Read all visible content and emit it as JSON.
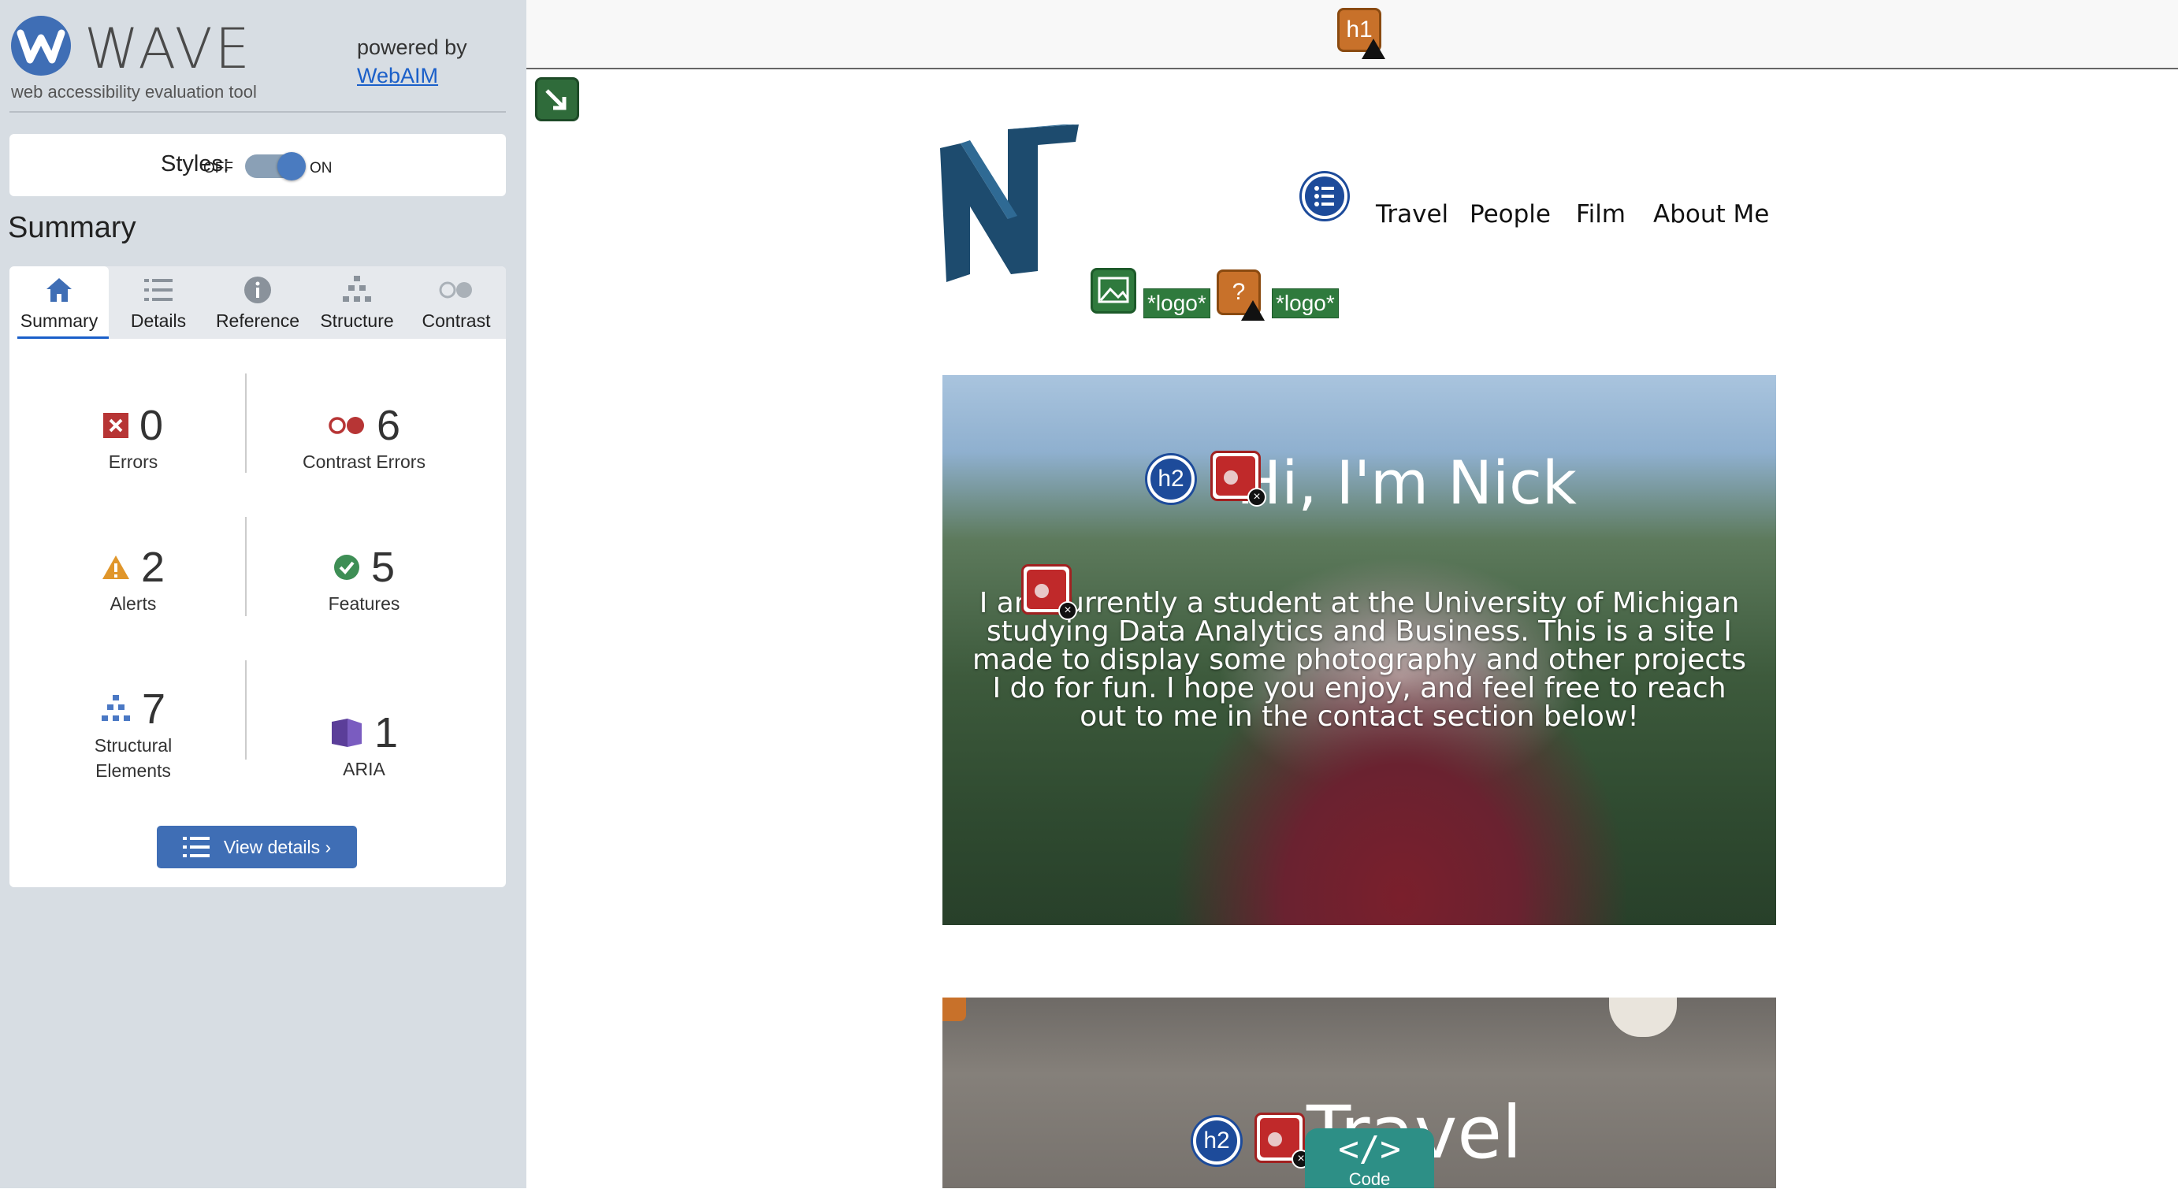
{
  "wave": {
    "name": "WAVE",
    "tagline": "web accessibility evaluation tool",
    "powered_by": "powered by",
    "powered_link": "WebAIM",
    "styles_label": "Styles:",
    "styles_off": "OFF",
    "styles_on": "ON",
    "summary_heading": "Summary",
    "tabs": [
      {
        "label": "Summary",
        "icon": "home-icon",
        "active": true
      },
      {
        "label": "Details",
        "icon": "list-icon",
        "active": false
      },
      {
        "label": "Reference",
        "icon": "info-icon",
        "active": false
      },
      {
        "label": "Structure",
        "icon": "structure-icon",
        "active": false
      },
      {
        "label": "Contrast",
        "icon": "contrast-icon",
        "active": false
      }
    ],
    "stats": {
      "errors": {
        "count": "0",
        "label": "Errors"
      },
      "contrast_errors": {
        "count": "6",
        "label": "Contrast Errors"
      },
      "alerts": {
        "count": "2",
        "label": "Alerts"
      },
      "features": {
        "count": "5",
        "label": "Features"
      },
      "structural": {
        "count": "7",
        "label1": "Structural",
        "label2": "Elements"
      },
      "aria": {
        "count": "1",
        "label": "ARIA"
      }
    },
    "view_details": "View details ›",
    "colors": {
      "error": "#b73535",
      "alert": "#e0962b",
      "feature": "#3e8e55",
      "structure": "#4a78c4",
      "aria": "#5b3e99",
      "button": "#3f6eb5"
    }
  },
  "page": {
    "h1_badge": "h1",
    "h2_badge": "h2",
    "logo_tag": "*logo*",
    "question_mark": "?",
    "nav": [
      "Travel",
      "People",
      "Film",
      "About Me"
    ],
    "hero_title": "Hi, I'm Nick",
    "hero_text": "I am currently a student at the University of Michigan studying Data Analytics and Business. This is a site I made to display some photography and other projects I do for fun. I hope you enjoy, and feel free to reach out to me in the contact section below!",
    "travel_title": "Travel",
    "code_label": "</>",
    "code_sub": "Code"
  }
}
